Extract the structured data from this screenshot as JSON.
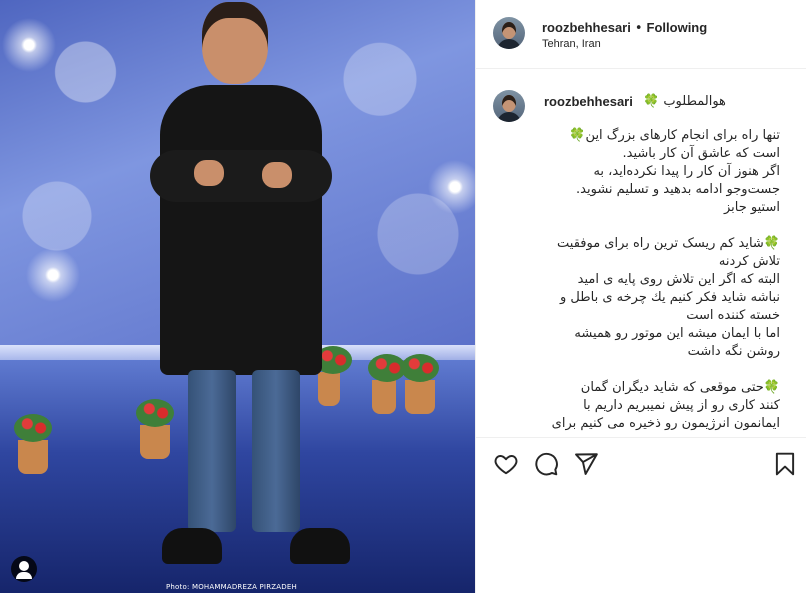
{
  "post": {
    "username": "roozbehhesari",
    "separator": "•",
    "follow_status": "Following",
    "location": "Tehran, Iran",
    "photo_credit": "Photo: MOHAMMADREZA PIRZADEH",
    "caption": {
      "username": "roozbehhesari",
      "first_line": "هوالمطلوب 🍀",
      "paragraphs": [
        [
          "تنها راه برای انجام کارهای بزرگ این🍀",
          "است که عاشق آن کار باشید.",
          "اگر هنوز آن کار را پیدا نکرده‌اید، به",
          "جست‌وجو ادامه بدهید و تسلیم نشوید.",
          "استیو جابز"
        ],
        [
          "🍀شاید کم ریسک ترین راه برای موفقیت",
          "تلاش کردنه",
          "البته که اگر این تلاش روی پایه ی امید",
          "نباشه شاید فکر کنیم یك چرخه ی باطل و",
          "خسته کننده است",
          "اما با ایمان میشه این موتور رو همیشه",
          "روشن نگه داشت"
        ],
        [
          "🍀حتی موقعی که شاید دیگران گمان",
          "کنند کاری رو از پیش نمیبریم داریم با",
          "ایمانمون انرژیمون رو ذخیره می کنیم برای"
        ]
      ]
    }
  },
  "actions": {
    "like_icon": "heart-icon",
    "comment_icon": "comment-icon",
    "share_icon": "paper-plane-icon",
    "save_icon": "bookmark-icon"
  }
}
